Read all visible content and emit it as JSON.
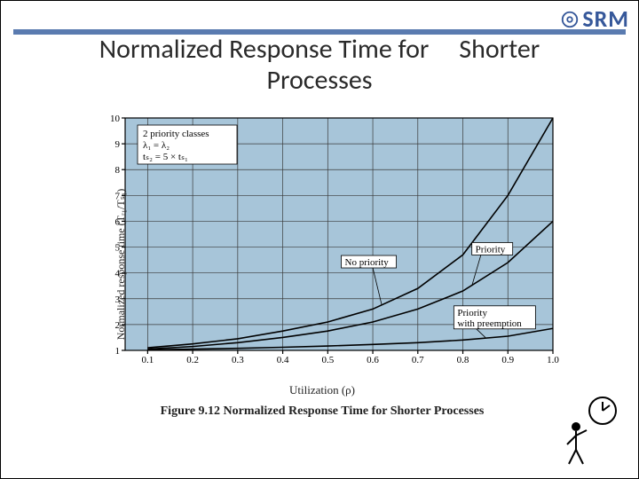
{
  "brand": "SRM",
  "title_line1": "Normalized Response Time for",
  "title_line2": "Processes",
  "title_right": "Shorter",
  "caption": "Figure 9.12 Normalized Response Time for Shorter Processes",
  "xlabel": "Utilization (ρ)",
  "ylabel_html": "Normalized response time (Tᵣ₁/Tₛ₁)",
  "legend_box_l1": "2 priority classes",
  "legend_box_l2": "λ₁ = λ₂",
  "legend_box_l3": "tₛ₂ = 5 × tₛ₁",
  "label_nopri": "No priority",
  "label_pri": "Priority",
  "label_preempt_l1": "Priority",
  "label_preempt_l2": "with preemption",
  "chart_data": {
    "type": "line",
    "title": "Normalized Response Time for Shorter Processes",
    "xlabel": "Utilization (ρ)",
    "ylabel": "Normalized response time (Tr1/Ts1)",
    "x": [
      0.1,
      0.2,
      0.3,
      0.4,
      0.5,
      0.6,
      0.7,
      0.8,
      0.9,
      1.0
    ],
    "xlim": [
      0.05,
      1.0
    ],
    "ylim": [
      1,
      10
    ],
    "grid": true,
    "annotations": [
      "2 priority classes",
      "λ1 = λ2",
      "ts2 = 5 × ts1"
    ],
    "series": [
      {
        "name": "No priority",
        "values": [
          1.1,
          1.25,
          1.45,
          1.75,
          2.1,
          2.6,
          3.4,
          4.7,
          7.0,
          10.0
        ]
      },
      {
        "name": "Priority",
        "values": [
          1.05,
          1.15,
          1.3,
          1.5,
          1.75,
          2.1,
          2.6,
          3.3,
          4.4,
          6.0
        ]
      },
      {
        "name": "Priority with preemption",
        "values": [
          1.02,
          1.05,
          1.08,
          1.12,
          1.17,
          1.23,
          1.3,
          1.4,
          1.55,
          1.85
        ]
      }
    ]
  }
}
